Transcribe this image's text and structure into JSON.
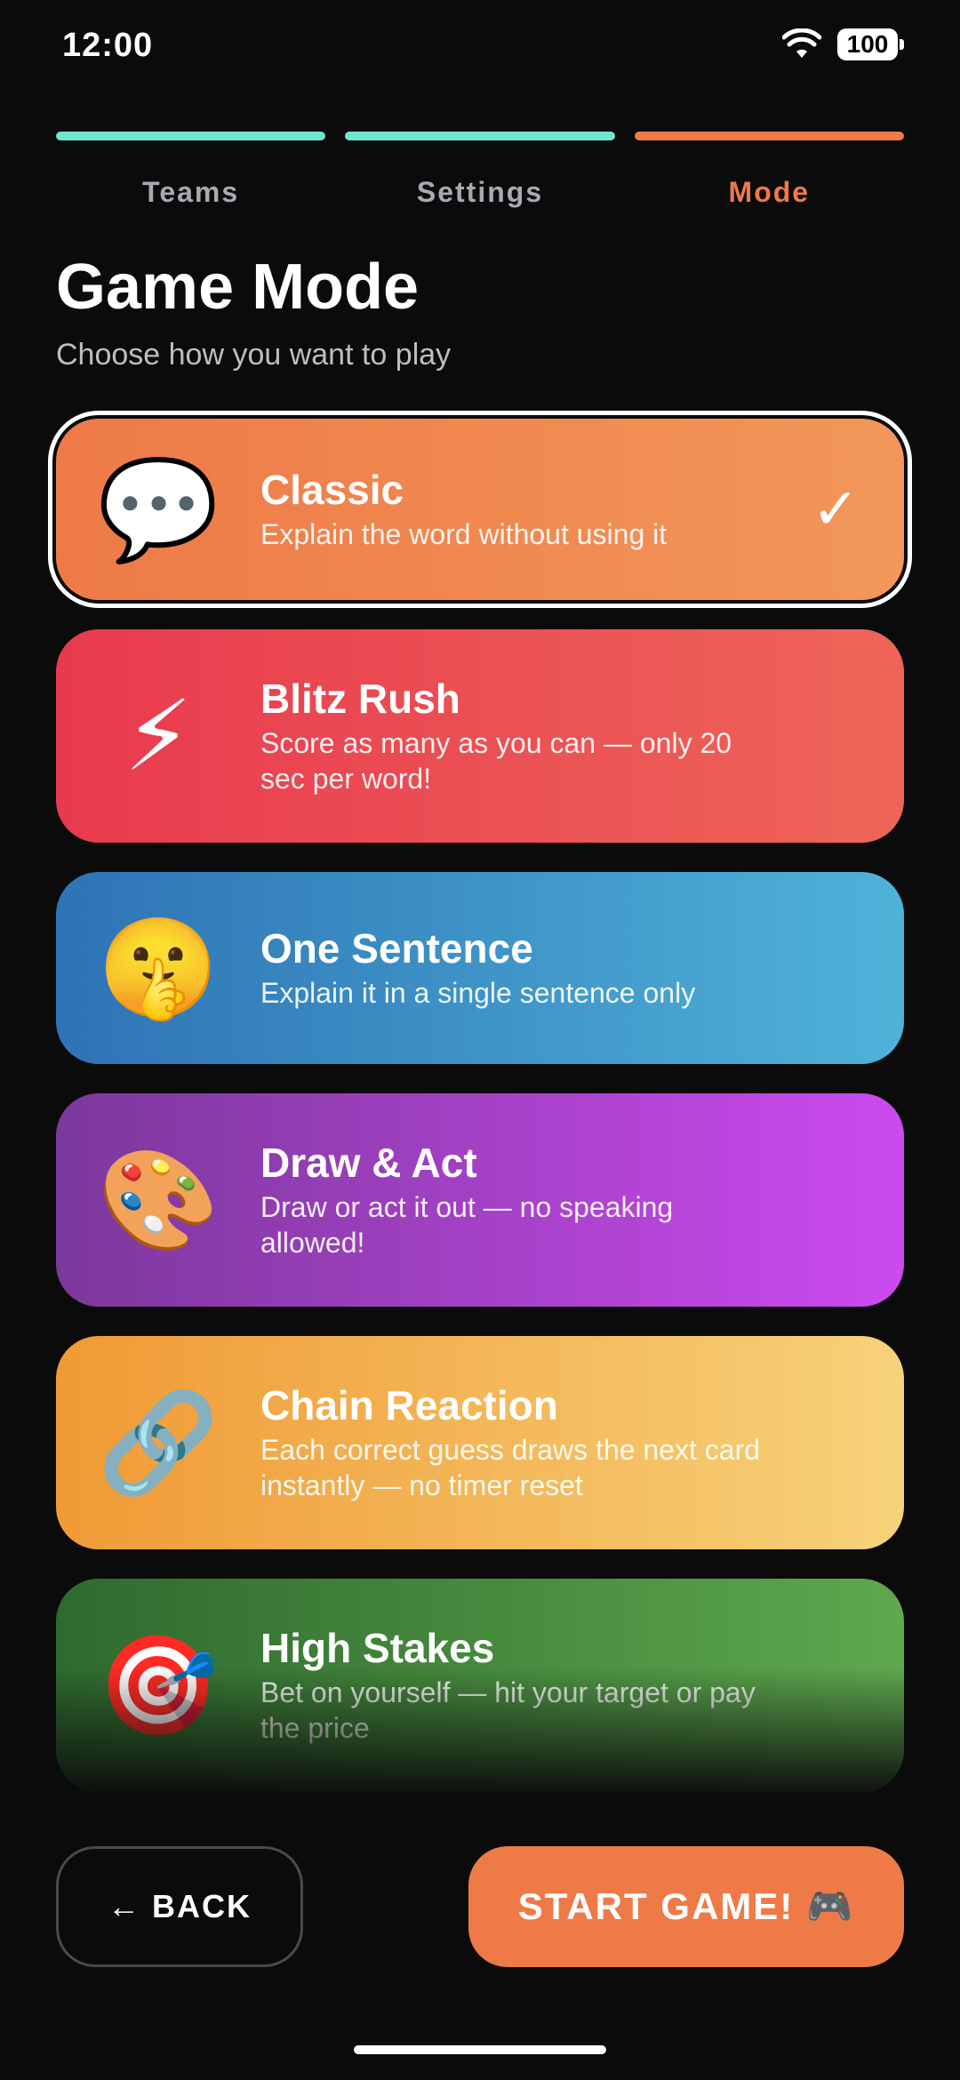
{
  "status_bar": {
    "time": "12:00",
    "battery": "100"
  },
  "steps": [
    {
      "label": "Teams",
      "color": "#6ee7cf",
      "active": false
    },
    {
      "label": "Settings",
      "color": "#6ee7cf",
      "active": false
    },
    {
      "label": "Mode",
      "color": "#ee7a47",
      "active": true
    }
  ],
  "header": {
    "title": "Game Mode",
    "subtitle": "Choose how you want to play"
  },
  "modes": [
    {
      "icon": "💬",
      "icon_name": "speech-bubble-icon",
      "title": "Classic",
      "desc": "Explain the word without using it",
      "selected": true,
      "colors": [
        "#ee7a47",
        "#f2975a"
      ]
    },
    {
      "icon": "⚡",
      "icon_name": "lightning-icon",
      "title": "Blitz Rush",
      "desc": "Score as many as you can — only 20 sec per word!",
      "selected": false,
      "colors": [
        "#e83a4e",
        "#ee6559"
      ]
    },
    {
      "icon": "🤫",
      "icon_name": "shushing-face-icon",
      "title": "One Sentence",
      "desc": "Explain it in a single sentence only",
      "selected": false,
      "colors": [
        "#2e73b5",
        "#4fb3d9"
      ]
    },
    {
      "icon": "🎨",
      "icon_name": "palette-icon",
      "title": "Draw & Act",
      "desc": "Draw or act it out — no speaking allowed!",
      "selected": false,
      "colors": [
        "#7b389b",
        "#cc4af0"
      ]
    },
    {
      "icon": "🔗",
      "icon_name": "link-icon",
      "title": "Chain Reaction",
      "desc": "Each correct guess draws the next card instantly — no timer reset",
      "selected": false,
      "colors": [
        "#f09a35",
        "#f7d27a"
      ]
    },
    {
      "icon": "🎯",
      "icon_name": "target-icon",
      "title": "High Stakes",
      "desc": "Bet on yourself — hit your target or pay the price",
      "selected": false,
      "colors": [
        "#2e6a2e",
        "#5ea84e"
      ]
    }
  ],
  "footer": {
    "back_label": "← BACK",
    "start_label": "START GAME! 🎮"
  }
}
